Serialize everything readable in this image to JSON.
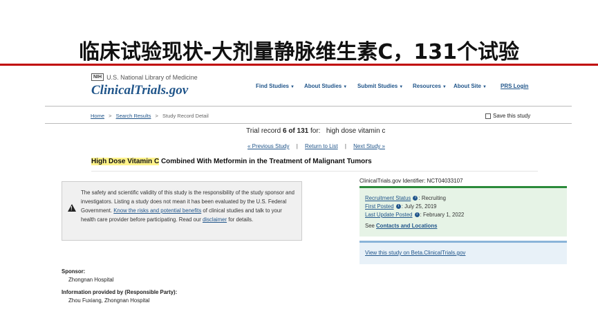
{
  "slide": {
    "title": "临床试验现状-大剂量静脉维生素C，131个试验"
  },
  "header": {
    "nih_badge": "NIH",
    "nih_text": "U.S. National Library of Medicine",
    "logo": "ClinicalTrials.gov",
    "nav": [
      "Find Studies",
      "About Studies",
      "Submit Studies",
      "Resources",
      "About Site"
    ],
    "prs_login": "PRS Login"
  },
  "breadcrumb": {
    "home": "Home",
    "search_results": "Search Results",
    "current": "Study Record Detail",
    "sep": ">"
  },
  "save_study": "Save this study",
  "record": {
    "prefix": "Trial record",
    "position": "6 of 131",
    "for_label": "for:",
    "query": "high dose vitamin c"
  },
  "pager": {
    "previous": "« Previous Study",
    "back": "Return to List",
    "next": "Next Study »",
    "sep": "|"
  },
  "study": {
    "title_highlight": "High Dose Vitamin C",
    "title_rest": " Combined With Metformin in the Treatment of Malignant Tumors"
  },
  "disclaimer": {
    "text_1": "The safety and scientific validity of this study is the responsibility of the study sponsor and investigators. Listing a study does not mean it has been evaluated by the U.S. Federal Government. ",
    "link_risks": "Know the risks and potential benefits",
    "text_2": " of clinical studies and talk to your health care provider before participating. Read our ",
    "link_disclaimer": "disclaimer",
    "text_3": " for details."
  },
  "status": {
    "identifier": "ClinicalTrials.gov Identifier: NCT04033107",
    "recruitment_label": "Recruitment Status",
    "recruitment_value": ": Recruiting",
    "first_posted_label": "First Posted",
    "first_posted_value": ": July 25, 2019",
    "last_update_label": "Last Update Posted",
    "last_update_value": ": February 1, 2022",
    "see": "See ",
    "contacts_link": "Contacts and Locations",
    "beta_link": "View this study on Beta.ClinicalTrials.gov",
    "info_glyph": "i"
  },
  "sponsor": {
    "label": "Sponsor:",
    "value": "Zhongnan Hospital",
    "info_label": "Information provided by (Responsible Party):",
    "info_value": "Zhou Fuxiang, Zhongnan Hospital"
  },
  "colors": {
    "accent": "#20558a",
    "red_rule": "#c00000",
    "green": "#2a8a3a"
  },
  "icons": [
    "warning-icon",
    "info-icon",
    "caret-down-icon",
    "checkbox-icon"
  ]
}
